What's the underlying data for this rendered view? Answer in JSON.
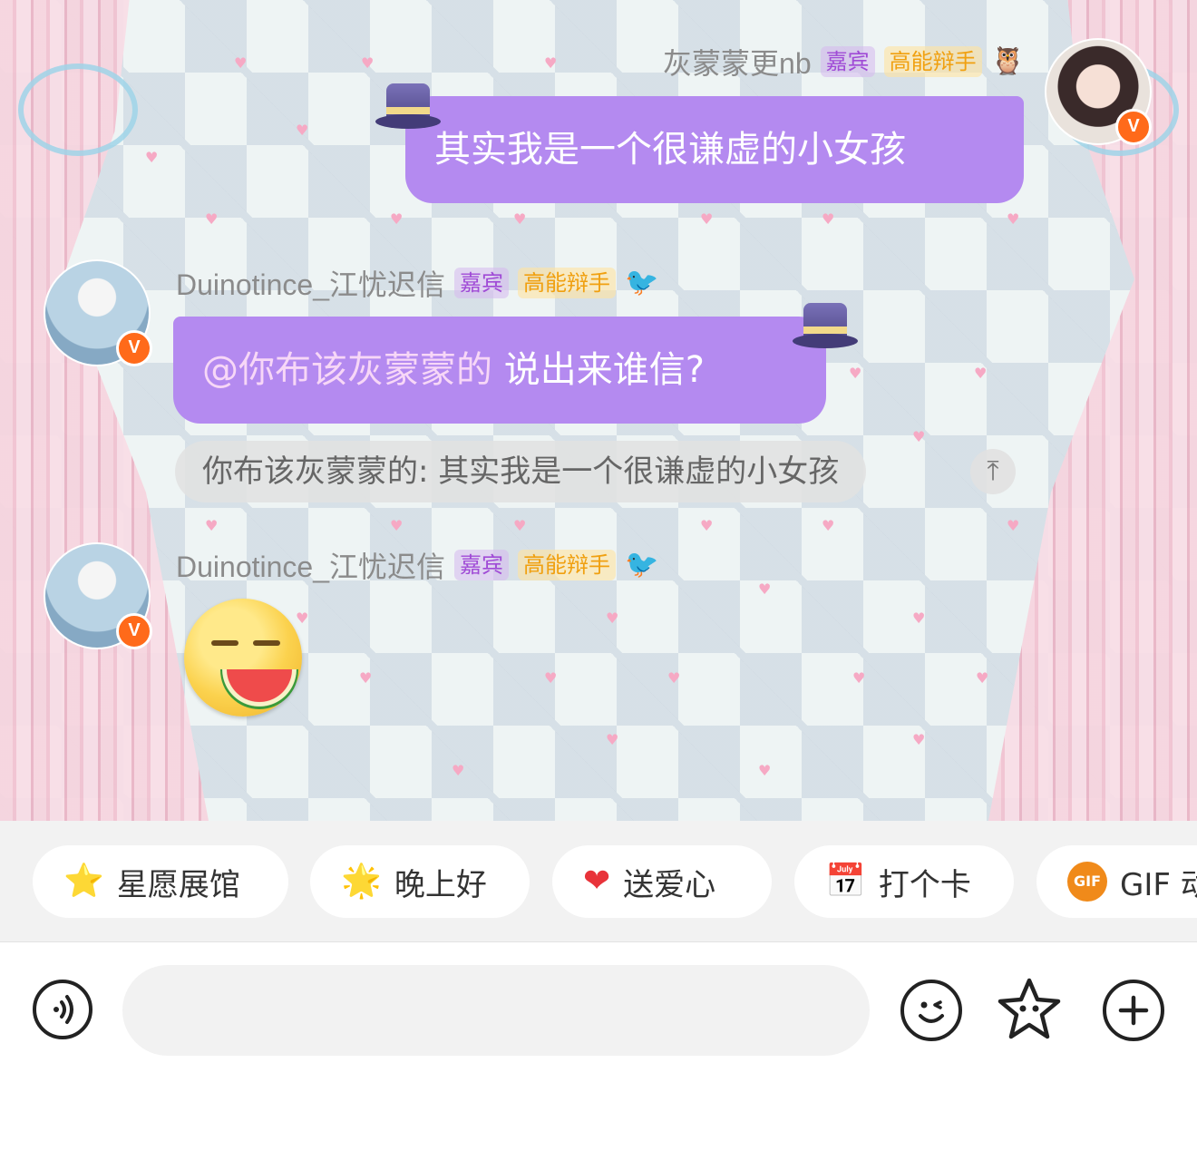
{
  "colors": {
    "bubble": "#b48af0",
    "guest_tag": "#a04bd6",
    "debater_tag": "#f0a010",
    "verified_badge": "#ff6a1a"
  },
  "messages": [
    {
      "side": "right",
      "username": "灰蒙蒙更nb",
      "tags": [
        "嘉宾",
        "高能辩手"
      ],
      "badge_icon": "owl-icon",
      "text": "其实我是一个很谦虚的小女孩"
    },
    {
      "side": "left",
      "username": "Duinotince_江忧迟信",
      "tags": [
        "嘉宾",
        "高能辩手"
      ],
      "badge_icon": "magpie-icon",
      "mention": "@你布该灰蒙蒙的",
      "text": "说出来谁信?",
      "quote": "你布该灰蒙蒙的: 其实我是一个很谦虚的小女孩"
    },
    {
      "side": "left",
      "username": "Duinotince_江忧迟信",
      "tags": [
        "嘉宾",
        "高能辩手"
      ],
      "badge_icon": "magpie-icon",
      "sticker": "eating-watermelon-emoji"
    }
  ],
  "quick_phrases": [
    {
      "icon": "star-icon",
      "glyph": "⭐",
      "label": "星愿展馆"
    },
    {
      "icon": "star-face-icon",
      "glyph": "🌟",
      "label": "晚上好"
    },
    {
      "icon": "heart-icon",
      "glyph": "❤",
      "label": "送爱心"
    },
    {
      "icon": "calendar-icon",
      "glyph": "📅",
      "label": "打个卡"
    },
    {
      "icon": "gif-icon",
      "glyph": "GIF",
      "label": "GIF 动"
    }
  ],
  "input": {
    "placeholder": "",
    "value": ""
  },
  "toolbar": {
    "voice_icon": "voice-icon",
    "emoji_icon": "smiley-icon",
    "sticker_icon": "star-sticker-icon",
    "plus_icon": "plus-icon"
  }
}
